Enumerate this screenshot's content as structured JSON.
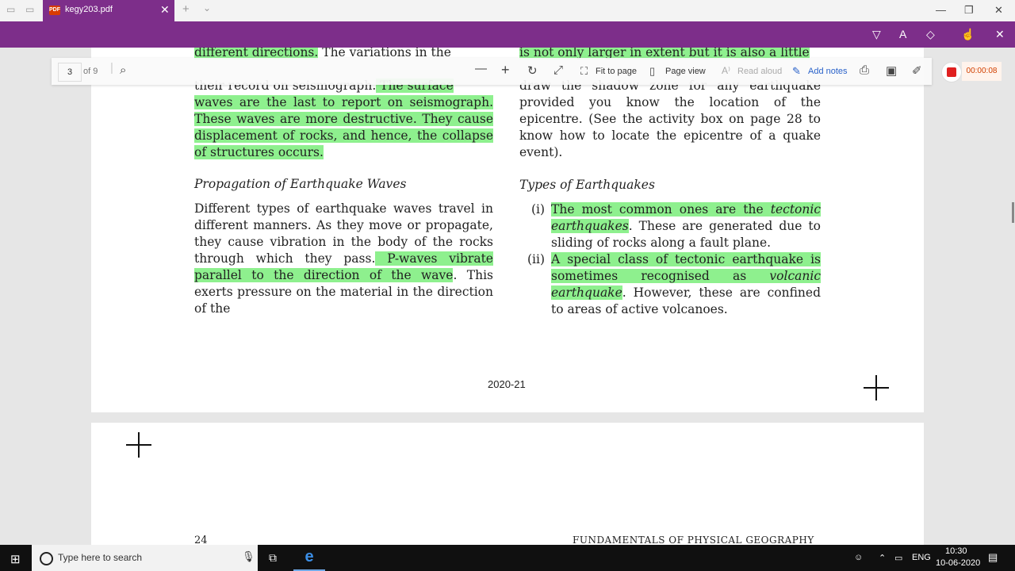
{
  "window": {
    "tab_title": "kegy203.pdf",
    "tab_icon": "pdf-icon",
    "close_tab": "✕",
    "new_tab": "+",
    "tab_list": "⌄",
    "minimize": "—",
    "maximize": "❐",
    "close": "✕"
  },
  "pdf_toolbar": {
    "page_number": "3",
    "page_total": "of 9",
    "fit_to_page": "Fit to page",
    "page_view": "Page view",
    "read_aloud": "Read aloud",
    "add_notes": "Add notes",
    "timer": "00:00:08"
  },
  "page": {
    "left_col": {
      "line1_hl": "different directions.",
      "line1_rest": " The variations in the",
      "line3_plain": "their record on seismograph.",
      "line3_hl": " The surface",
      "para1_hl": "waves are the last to report on seismograph. These waves are more destructive. They cause displacement of rocks, and hence, the collapse of structures occurs.",
      "heading": "Propagation of Earthquake Waves",
      "para2_plain": "Different types of earthquake waves travel in different manners. As they move or propagate, they cause vibration in the body of the rocks through which they pass.",
      "para2_hl": " P-waves vibrate parallel to the direction of the wave",
      "para2_rest": ". This exerts pressure on the material in the direction of the"
    },
    "right_col": {
      "line1_hl": "is not only larger in extent but it is also a little",
      "para1": "draw the shadow zone for any earthquake provided you know the location of the epicentre. (See the activity box on page 28 to know how to locate the epicentre of a quake event).",
      "heading": "Types of Earthquakes",
      "item1_num": "(i)",
      "item1_hl_a": " The most common ones are the ",
      "item1_hl_i": "tectonic earthquakes",
      "item1_rest": ". These are generated due to sliding of rocks along a fault plane.",
      "item2_num": "(ii)",
      "item2_hl_a": " A special class of tectonic earthquake is sometimes recognised as ",
      "item2_hl_i": "volcanic earthquake",
      "item2_rest": ". However, these are confined to areas of active volcanoes."
    },
    "footer_year": "2020-21",
    "next_page_number": "24",
    "next_page_header": "FUNDAMENTALS OF PHYSICAL GEOGRAPHY"
  },
  "taskbar": {
    "search_placeholder": "Type here to search",
    "language": "ENG",
    "time": "10:30",
    "date": "10-06-2020"
  },
  "colors": {
    "accent": "#7d2e8a",
    "highlight": "#8ef08e",
    "record": "#e02020"
  }
}
